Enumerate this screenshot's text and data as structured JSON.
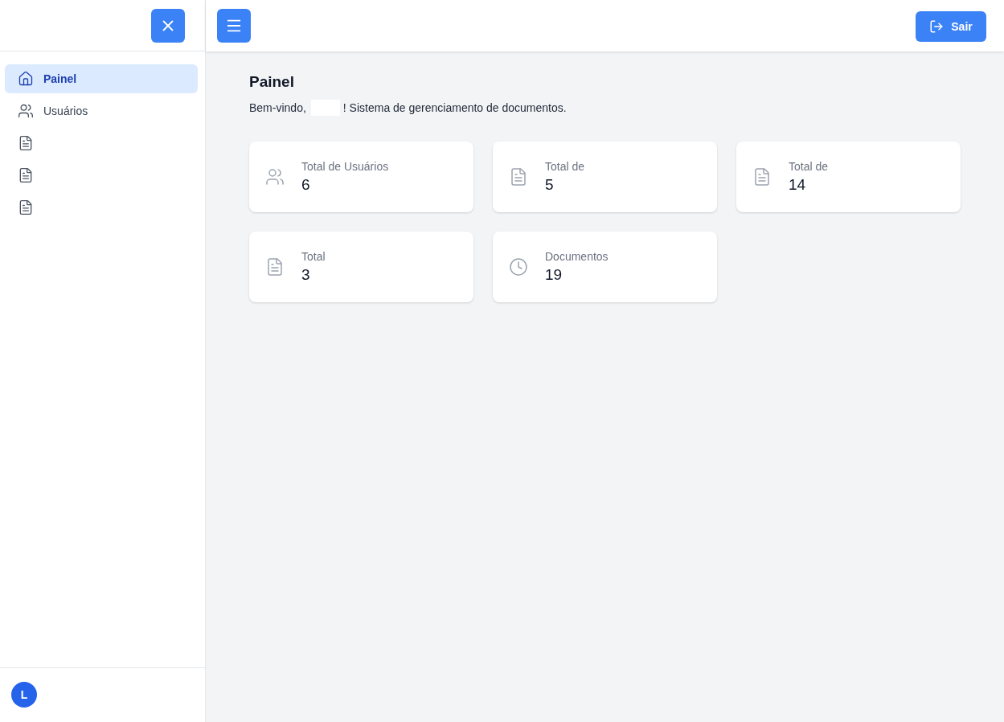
{
  "sidebar": {
    "items": [
      {
        "kind": "home",
        "label": "Painel",
        "selected": true
      },
      {
        "kind": "users",
        "label": "Usuários",
        "selected": false
      },
      {
        "kind": "document",
        "selected": false
      },
      {
        "kind": "document",
        "selected": false
      },
      {
        "kind": "document",
        "selected": false
      }
    ],
    "user": {
      "initial": "L"
    }
  },
  "topbar": {
    "logout_label": "Sair"
  },
  "page": {
    "title": "Painel",
    "greeting": "Bem-vindo,",
    "message": "! Sistema de gerenciamento de documentos."
  },
  "stats": [
    {
      "kind": "users",
      "label": "Total de Usuários",
      "value": "6"
    },
    {
      "kind": "document",
      "label": "Total de",
      "value": "5"
    },
    {
      "kind": "document",
      "label": "Total de",
      "value": "14"
    },
    {
      "kind": "document",
      "label": "Total",
      "value": "3"
    },
    {
      "kind": "clock",
      "label": "Documentos",
      "value": "19"
    }
  ]
}
